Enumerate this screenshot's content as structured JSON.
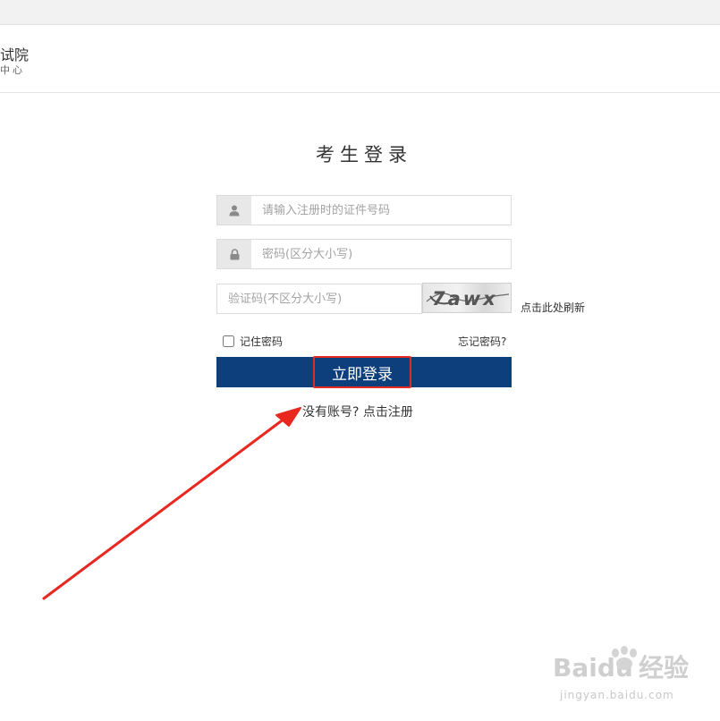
{
  "header": {
    "brand_title": "试院",
    "brand_subtitle": "中心"
  },
  "login": {
    "title": "考生登录",
    "id_placeholder": "请输入注册时的证件号码",
    "password_placeholder": "密码(区分大小写)",
    "captcha_placeholder": "验证码(不区分大小写)",
    "captcha_text": "7awx",
    "refresh_label": "点击此处刷新",
    "remember_label": "记住密码",
    "forgot_label": "忘记密码?",
    "submit_label": "立即登录",
    "register_label": "没有账号? 点击注册"
  },
  "watermark": {
    "brand": "Baidu",
    "suffix": "经验",
    "url": "jingyan.baidu.com"
  },
  "colors": {
    "login_bar": "#0d3f7d",
    "highlight_red": "#e32b22",
    "arrow_red": "#e8271f"
  }
}
